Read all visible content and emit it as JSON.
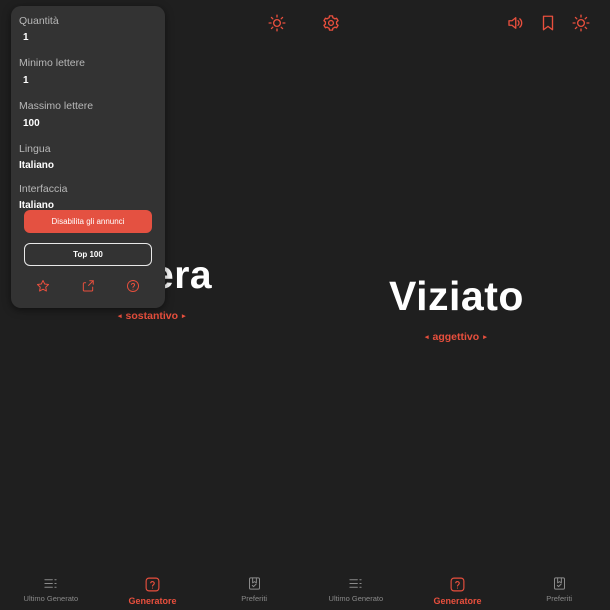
{
  "left_screen": {
    "word_visible": "era",
    "part_of_speech": "sostantivo",
    "settings_popup": {
      "quantity_label": "Quantità",
      "quantity_value": "1",
      "min_letters_label": "Minimo lettere",
      "min_letters_value": "1",
      "max_letters_label": "Massimo lettere",
      "max_letters_value": "100",
      "language_label": "Lingua",
      "language_value": "Italiano",
      "interface_label": "Interfaccia",
      "interface_value": "Italiano",
      "disable_ads_label": "Disabilita gli annunci",
      "top100_label": "Top 100",
      "action_icons": [
        "star-icon",
        "share-icon",
        "help-icon"
      ]
    },
    "top_icons": [
      "sun-icon",
      "gear-icon"
    ]
  },
  "right_screen": {
    "word": "Viziato",
    "part_of_speech": "aggettivo",
    "top_icons": [
      "speaker-icon",
      "bookmark-icon",
      "sun-icon"
    ]
  },
  "bottom_nav": {
    "items": [
      {
        "label": "Ultimo Generato",
        "icon": "list-icon",
        "active": false
      },
      {
        "label": "Generatore",
        "icon": "question-icon",
        "active": true
      },
      {
        "label": "Preferiti",
        "icon": "bookmark-check-icon",
        "active": false
      }
    ]
  },
  "colors": {
    "background": "#1f1f1f",
    "accent": "#e84f3d",
    "popup": "#333333",
    "inactive": "#8a8a8a"
  }
}
